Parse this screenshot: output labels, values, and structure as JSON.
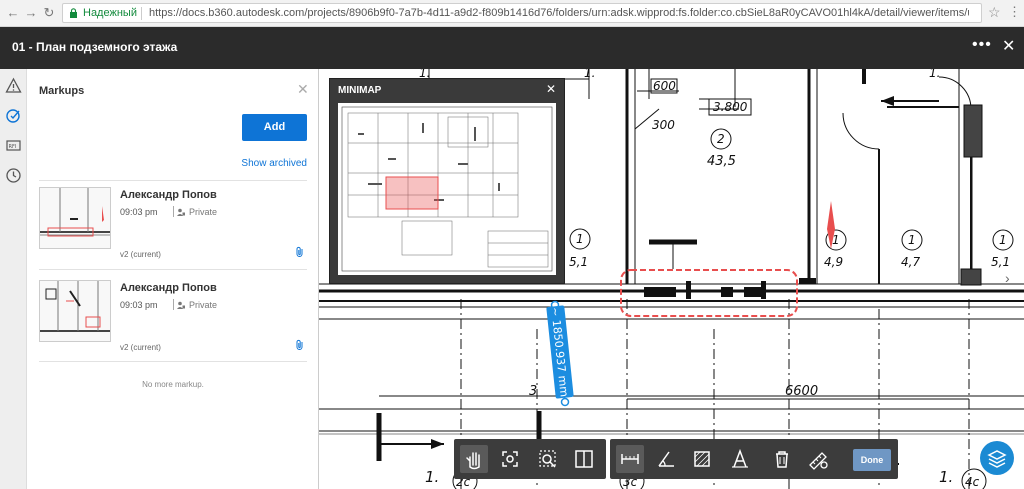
{
  "browser": {
    "secure_label": "Надежный",
    "url": "https://docs.b360.autodesk.com/projects/8906b9f0-7a7b-4d11-a9d2-f809b1416d76/folders/urn:adsk.wipprod:fs.folder:co.cbSieL8aR0yCAVO01hl4kA/detail/viewer/items/ur..."
  },
  "app": {
    "title": "01 - План подземного этажа"
  },
  "panel": {
    "title": "Markups",
    "add_label": "Add",
    "show_archived": "Show archived",
    "no_more": "No more markup.",
    "items": [
      {
        "author": "Александр Попов",
        "time": "09:03 pm",
        "privacy": "Private",
        "version": "v2 (current)"
      },
      {
        "author": "Александр Попов",
        "time": "09:03 pm",
        "privacy": "Private",
        "version": "v2 (current)"
      }
    ]
  },
  "minimap": {
    "title": "MINIMAP"
  },
  "drawing": {
    "labels": {
      "dim_600": "600",
      "dim_3800": "3.800",
      "dim_300": "300",
      "room_2": "2",
      "area_43_5": "43,5",
      "tag_1a": "1",
      "val_5_1a": "5,1",
      "tag_1b": "1",
      "val_4_9": "4,9",
      "tag_1c": "1",
      "val_4_7": "4,7",
      "tag_1d": "1",
      "val_5_1b": "5,1",
      "dim_6600": "6600",
      "dim_3": "3",
      "label_1a": "1.",
      "label_1b": "1.",
      "label_1c": "1.",
      "label_1d": "1.",
      "label_1e": "1.",
      "axis_2c": "2c",
      "axis_3c": "3c",
      "axis_4c": "4c"
    },
    "measure": "~ 1850.937 mm"
  },
  "toolbar": {
    "done_label": "Done"
  },
  "colors": {
    "accent": "#0e74d6",
    "markup_red": "#e84e4e",
    "measure_blue": "#1c8de0",
    "header": "#2b2b2b"
  }
}
